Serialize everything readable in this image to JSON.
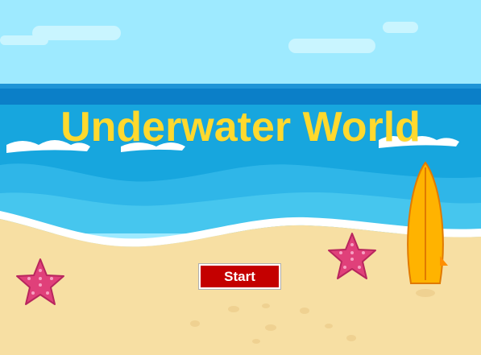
{
  "game": {
    "title": "Underwater World",
    "start_label": "Start"
  },
  "colors": {
    "sky": "#9eeaff",
    "sea_deep": "#0b7fc8",
    "sea": "#17a6de",
    "sea_light": "#46c6ee",
    "sand": "#f7dfa3",
    "title": "#ffd92e",
    "button": "#c40000",
    "starfish": "#e0407a",
    "surfboard": "#ffb300"
  },
  "icons": [
    "starfish-icon",
    "surfboard-icon",
    "cloud-icon"
  ]
}
